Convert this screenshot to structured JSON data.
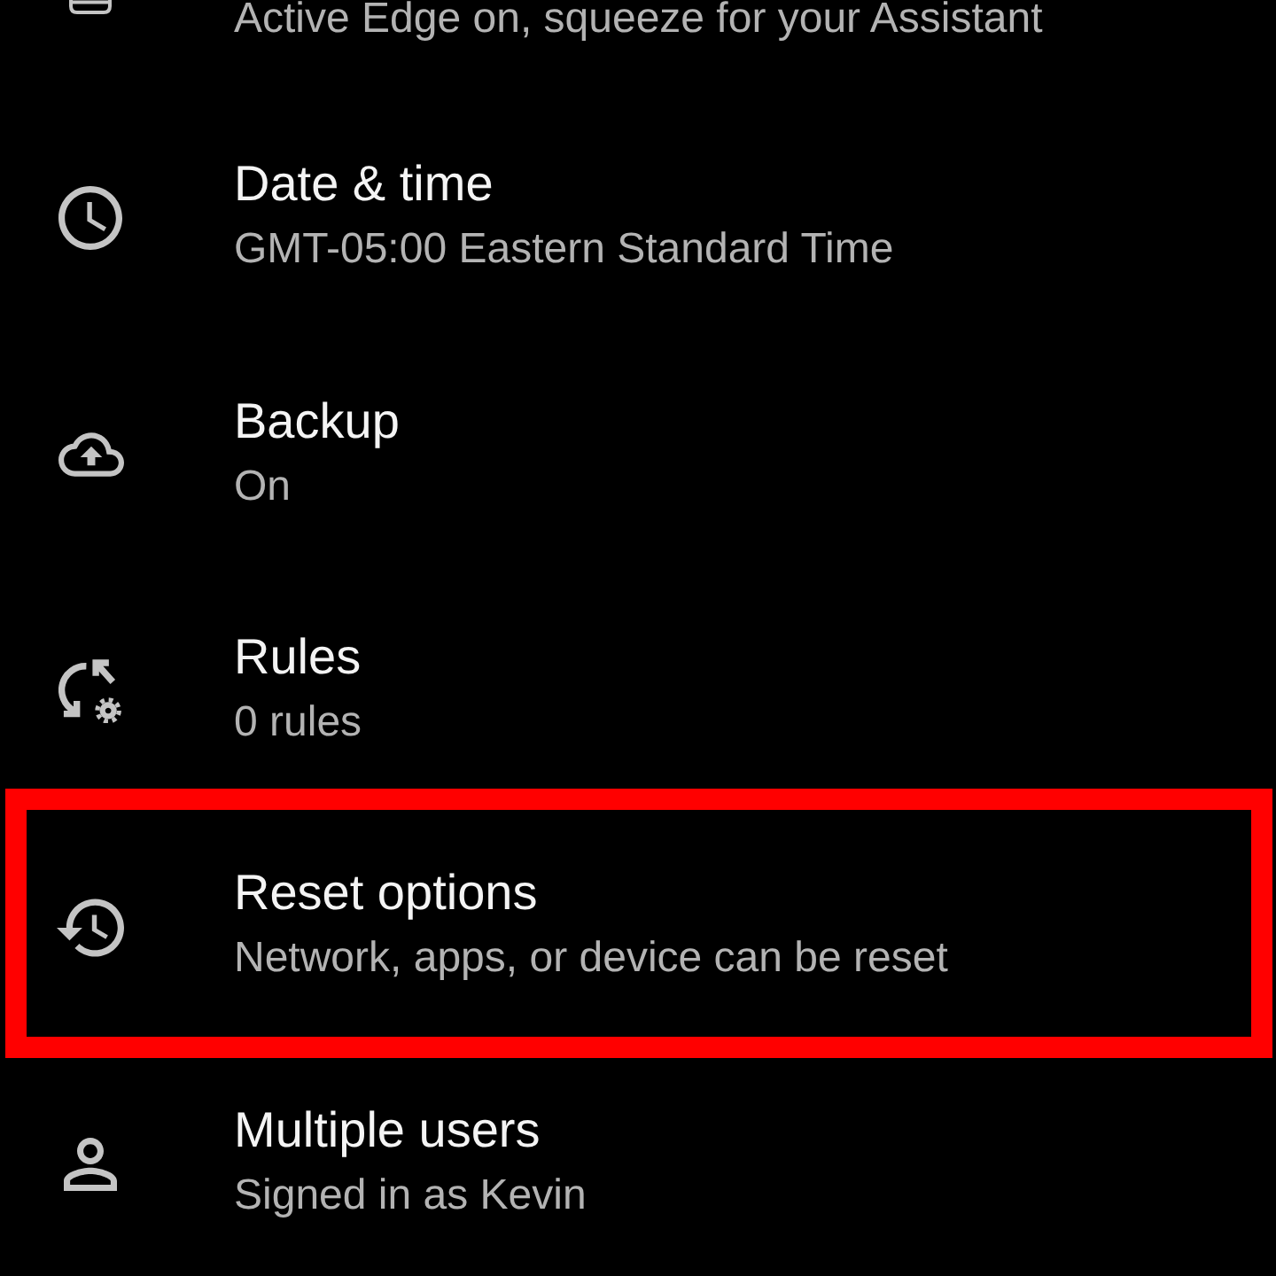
{
  "items": [
    {
      "subtitle": "Active Edge on, squeeze for your Assistant",
      "highlighted": false
    },
    {
      "title": "Date & time",
      "subtitle": "GMT-05:00 Eastern Standard Time",
      "highlighted": false
    },
    {
      "title": "Backup",
      "subtitle": "On",
      "highlighted": false
    },
    {
      "title": "Rules",
      "subtitle": "0 rules",
      "highlighted": false
    },
    {
      "title": "Reset options",
      "subtitle": "Network, apps, or device can be reset",
      "highlighted": true
    },
    {
      "title": "Multiple users",
      "subtitle": "Signed in as Kevin",
      "highlighted": false
    }
  ]
}
